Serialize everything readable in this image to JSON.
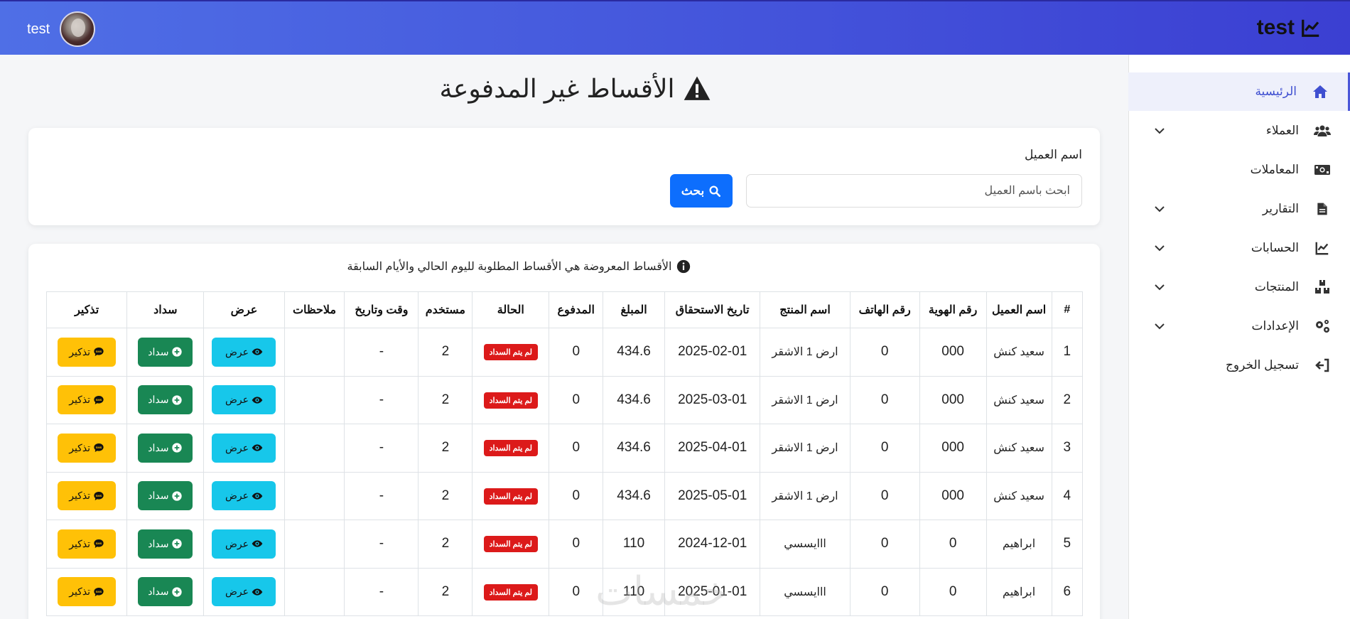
{
  "navbar": {
    "brand": "test",
    "username": "test"
  },
  "sidebar": {
    "items": [
      {
        "label": "الرئيسية",
        "icon": "home-icon",
        "active": true,
        "chevron": false
      },
      {
        "label": "العملاء",
        "icon": "users-icon",
        "active": false,
        "chevron": true
      },
      {
        "label": "المعاملات",
        "icon": "money-icon",
        "active": false,
        "chevron": false
      },
      {
        "label": "التقارير",
        "icon": "file-icon",
        "active": false,
        "chevron": true
      },
      {
        "label": "الحسابات",
        "icon": "chart-line-icon",
        "active": false,
        "chevron": true
      },
      {
        "label": "المنتجات",
        "icon": "boxes-icon",
        "active": false,
        "chevron": true
      },
      {
        "label": "الإعدادات",
        "icon": "gears-icon",
        "active": false,
        "chevron": true
      },
      {
        "label": "تسجيل الخروج",
        "icon": "logout-icon",
        "active": false,
        "chevron": false
      }
    ]
  },
  "page": {
    "title": "الأقساط غير المدفوعة"
  },
  "search": {
    "label": "اسم العميل",
    "placeholder": "ابحث باسم العميل",
    "button_label": "بحث"
  },
  "table": {
    "note": "الأقساط المعروضة هي الأقساط المطلوبة لليوم الحالي والأيام السابقة",
    "headers": [
      "#",
      "اسم العميل",
      "رقم الهوية",
      "رقم الهاتف",
      "اسم المنتج",
      "تاريخ الاستحقاق",
      "المبلغ",
      "المدفوع",
      "الحالة",
      "مستخدم",
      "وقت وتاريخ",
      "ملاحظات",
      "عرض",
      "سداد",
      "تذكير"
    ],
    "view_label": "عرض",
    "pay_label": "سداد",
    "remind_label": "تذكير",
    "rows": [
      {
        "num": "1",
        "client": "سعيد كنش",
        "id": "000",
        "phone": "0",
        "product": "ارض 1 الاشقر",
        "due": "2025-02-01",
        "amount": "434.6",
        "paid": "0",
        "status": "لم يتم السداد",
        "user": "2",
        "datetime": "-",
        "notes": ""
      },
      {
        "num": "2",
        "client": "سعيد كنش",
        "id": "000",
        "phone": "0",
        "product": "ارض 1 الاشقر",
        "due": "2025-03-01",
        "amount": "434.6",
        "paid": "0",
        "status": "لم يتم السداد",
        "user": "2",
        "datetime": "-",
        "notes": ""
      },
      {
        "num": "3",
        "client": "سعيد كنش",
        "id": "000",
        "phone": "0",
        "product": "ارض 1 الاشقر",
        "due": "2025-04-01",
        "amount": "434.6",
        "paid": "0",
        "status": "لم يتم السداد",
        "user": "2",
        "datetime": "-",
        "notes": ""
      },
      {
        "num": "4",
        "client": "سعيد كنش",
        "id": "000",
        "phone": "0",
        "product": "ارض 1 الاشقر",
        "due": "2025-05-01",
        "amount": "434.6",
        "paid": "0",
        "status": "لم يتم السداد",
        "user": "2",
        "datetime": "-",
        "notes": ""
      },
      {
        "num": "5",
        "client": "ابراهيم",
        "id": "0",
        "phone": "0",
        "product": "ااايسسي",
        "due": "2024-12-01",
        "amount": "110",
        "paid": "0",
        "status": "لم يتم السداد",
        "user": "2",
        "datetime": "-",
        "notes": ""
      },
      {
        "num": "6",
        "client": "ابراهيم",
        "id": "0",
        "phone": "0",
        "product": "ااايسسي",
        "due": "2025-01-01",
        "amount": "110",
        "paid": "0",
        "status": "لم يتم السداد",
        "user": "2",
        "datetime": "-",
        "notes": ""
      }
    ]
  },
  "watermark": "خمسات",
  "colors": {
    "navbar_start": "#4f6fe6",
    "navbar_end": "#3b3fd2",
    "primary": "#0d6efd",
    "view": "#17c7ea",
    "pay": "#198754",
    "remind": "#ffc107",
    "danger": "#dc1a1a",
    "active_side": "#3f4fd0"
  }
}
